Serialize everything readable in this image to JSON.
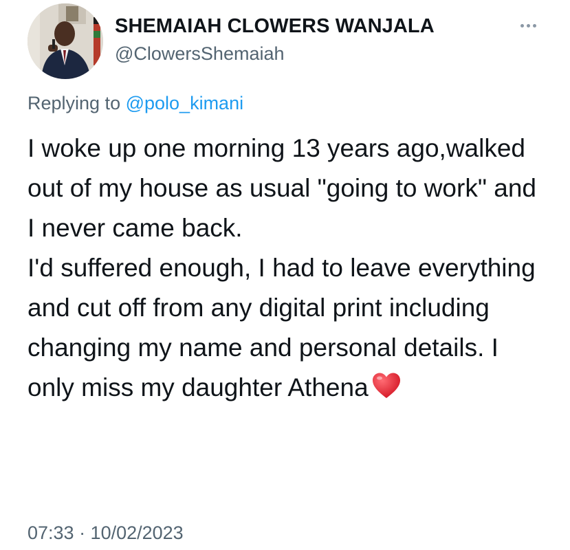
{
  "author": {
    "display_name": "SHEMAIAH CLOWERS WANJALA",
    "handle": "@ClowersShemaiah"
  },
  "reply": {
    "prefix": "Replying to ",
    "mention": "@polo_kimani"
  },
  "tweet": {
    "text": "I woke up one morning 13 years ago,walked out of my house as usual \"going to work\" and I never came back.\nI'd suffered enough, I had to leave everything and cut off from any digital print including changing my name and personal details. I only miss my daughter Athena",
    "emoji": "heart-icon"
  },
  "meta": {
    "timestamp": "07:33 · 10/02/2023"
  },
  "colors": {
    "link": "#1d9bf0",
    "secondary_text": "#536471",
    "primary_text": "#0f1419",
    "heart": "#e0202e"
  }
}
